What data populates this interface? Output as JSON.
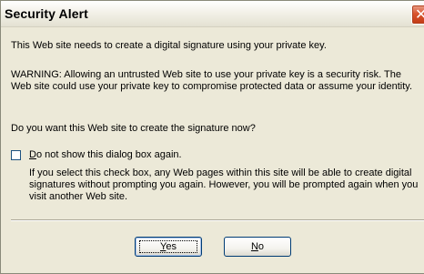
{
  "window": {
    "title": "Security Alert"
  },
  "content": {
    "line1": "This Web site needs to create a digital signature using your private key.",
    "warning": "WARNING: Allowing an untrusted Web site to use your private key is a security risk. The Web site could use your private key to compromise protected data or assume your identity.",
    "question": "Do you want this Web site to create the signature now?",
    "checkbox": {
      "accel": "D",
      "label_rest": "o not show this dialog box again.",
      "checked": false
    },
    "checkbox_note": "If you select this check box, any Web pages within this site will be able to create digital signatures without prompting you again. However, you will be prompted again when you visit another Web site."
  },
  "buttons": {
    "yes": {
      "accel": "Y",
      "rest": "es"
    },
    "no": {
      "accel": "N",
      "rest": "o"
    }
  },
  "icons": {
    "close": "close-icon"
  },
  "colors": {
    "dialog_bg": "#ece9d8",
    "close_button": "#d9542e",
    "button_border": "#003c74"
  }
}
